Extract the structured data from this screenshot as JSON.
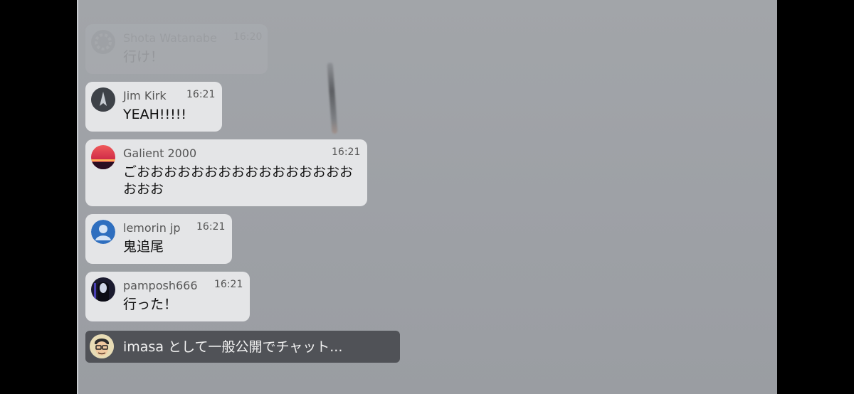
{
  "chat": {
    "messages": [
      {
        "author": "Shota Watanabe",
        "time": "16:20",
        "text": "行け！",
        "avatar": "gear-avatar"
      },
      {
        "author": "Jim Kirk",
        "time": "16:21",
        "text": "YEAH!!!!!",
        "avatar": "ship-avatar"
      },
      {
        "author": "Galient 2000",
        "time": "16:21",
        "text": "ごおおおおおおおおおおおおおおおおおおお",
        "avatar": "sunset-avatar"
      },
      {
        "author": "lemorin jp",
        "time": "16:21",
        "text": "鬼追尾",
        "avatar": "default-person-avatar"
      },
      {
        "author": "pamposh666",
        "time": "16:21",
        "text": "行った！",
        "avatar": "portrait-avatar"
      }
    ],
    "input": {
      "placeholder": "imasa として一般公開でチャット...",
      "avatar": "glasses-avatar"
    }
  },
  "colors": {
    "bubble": "#e4e5e7",
    "input_bar": "#46484c",
    "default_avatar": "#2f6fbf"
  }
}
